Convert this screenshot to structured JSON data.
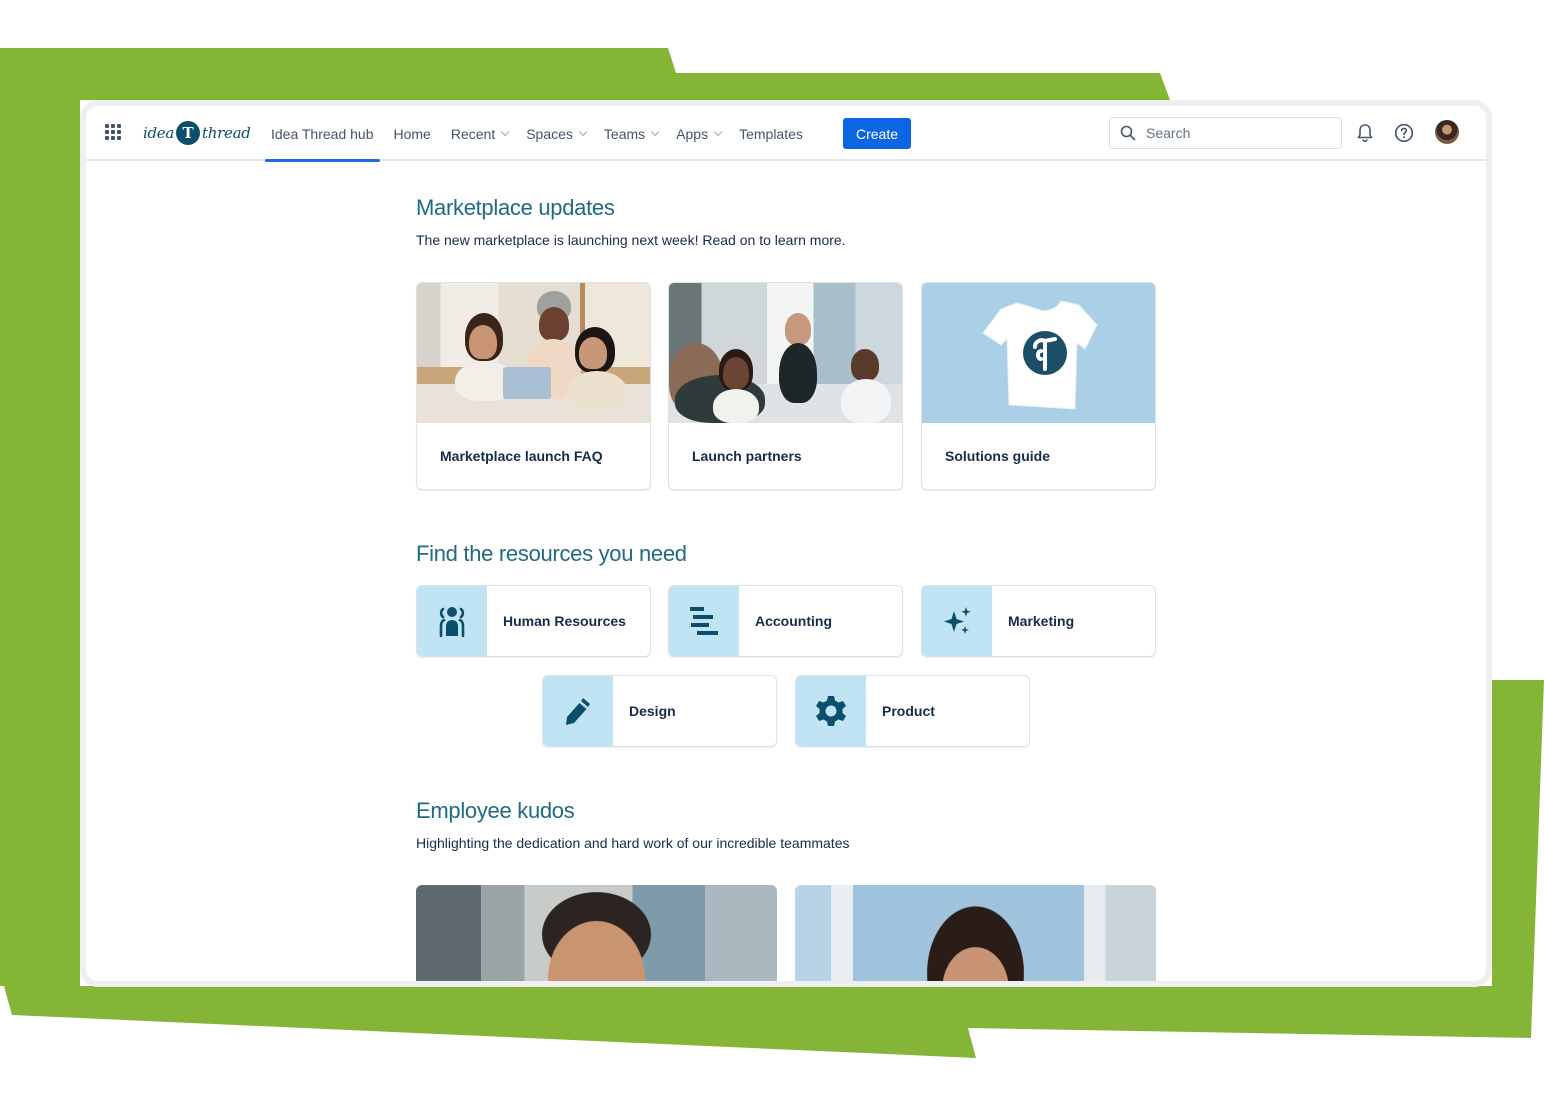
{
  "theme": {
    "accent": "#0c66e4",
    "heading_color": "#206a83",
    "tile_icon_bg": "#c1e4f5",
    "icon_color": "#0b4f6c",
    "backdrop_green": "#84b537"
  },
  "logo": {
    "left_text": "idea",
    "mark": "T",
    "right_text": "thread"
  },
  "nav": {
    "items": [
      {
        "label": "Idea Thread hub",
        "dropdown": false,
        "active": true
      },
      {
        "label": "Home",
        "dropdown": false,
        "active": false
      },
      {
        "label": "Recent",
        "dropdown": true,
        "active": false
      },
      {
        "label": "Spaces",
        "dropdown": true,
        "active": false
      },
      {
        "label": "Teams",
        "dropdown": true,
        "active": false
      },
      {
        "label": "Apps",
        "dropdown": true,
        "active": false
      },
      {
        "label": "Templates",
        "dropdown": false,
        "active": false
      }
    ],
    "create_label": "Create",
    "search_placeholder": "Search",
    "icons": [
      "apps-grid-icon",
      "search-icon",
      "bell-icon",
      "help-icon",
      "avatar"
    ]
  },
  "marketplace": {
    "title": "Marketplace updates",
    "subtitle": "The new marketplace is launching next week! Read on to learn more.",
    "cards": [
      {
        "label": "Marketplace launch FAQ"
      },
      {
        "label": "Launch partners"
      },
      {
        "label": "Solutions guide"
      }
    ]
  },
  "resources": {
    "title": "Find the resources you need",
    "tiles": [
      {
        "label": "Human Resources",
        "icon": "people-icon"
      },
      {
        "label": "Accounting",
        "icon": "bars-icon"
      },
      {
        "label": "Marketing",
        "icon": "sparkle-icon"
      },
      {
        "label": "Design",
        "icon": "pencil-icon"
      },
      {
        "label": "Product",
        "icon": "gear-icon"
      }
    ]
  },
  "kudos": {
    "title": "Employee kudos",
    "subtitle": "Highlighting the dedication and hard work of our incredible teammates"
  }
}
